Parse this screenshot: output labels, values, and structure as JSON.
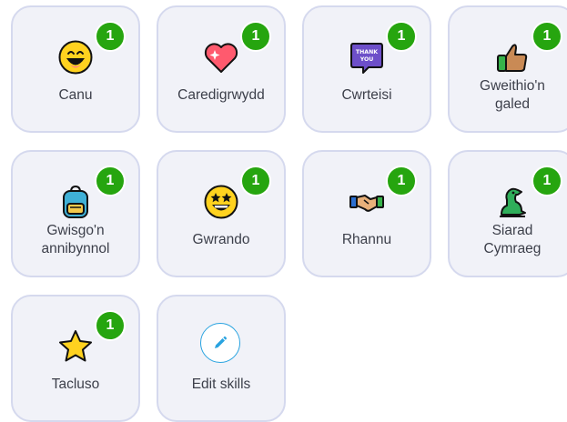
{
  "skills": [
    {
      "label": "Canu",
      "count": "1",
      "icon": "grinning-face-icon"
    },
    {
      "label": "Caredigrwydd",
      "count": "1",
      "icon": "sparkling-heart-icon"
    },
    {
      "label": "Cwrteisi",
      "count": "1",
      "icon": "thank-you-bubble-icon",
      "icon_text": "THANK YOU"
    },
    {
      "label_line1": "Gweithio'n",
      "label_line2": "galed",
      "count": "1",
      "icon": "thumbs-up-icon"
    },
    {
      "label_line1": "Gwisgo'n",
      "label_line2": "annibynnol",
      "count": "1",
      "icon": "backpack-icon"
    },
    {
      "label": "Gwrando",
      "count": "1",
      "icon": "star-struck-face-icon"
    },
    {
      "label": "Rhannu",
      "count": "1",
      "icon": "handshake-icon"
    },
    {
      "label_line1": "Siarad",
      "label_line2": "Cymraeg",
      "count": "1",
      "icon": "dragon-icon"
    },
    {
      "label": "Tacluso",
      "count": "1",
      "icon": "star-icon"
    }
  ],
  "edit": {
    "label": "Edit skills",
    "icon": "pencil-icon"
  },
  "colors": {
    "card_bg": "#f1f2f8",
    "card_border": "#d5d9ee",
    "badge": "#26a50f",
    "edit_accent": "#29a3e0",
    "label": "#3c3f4a"
  }
}
